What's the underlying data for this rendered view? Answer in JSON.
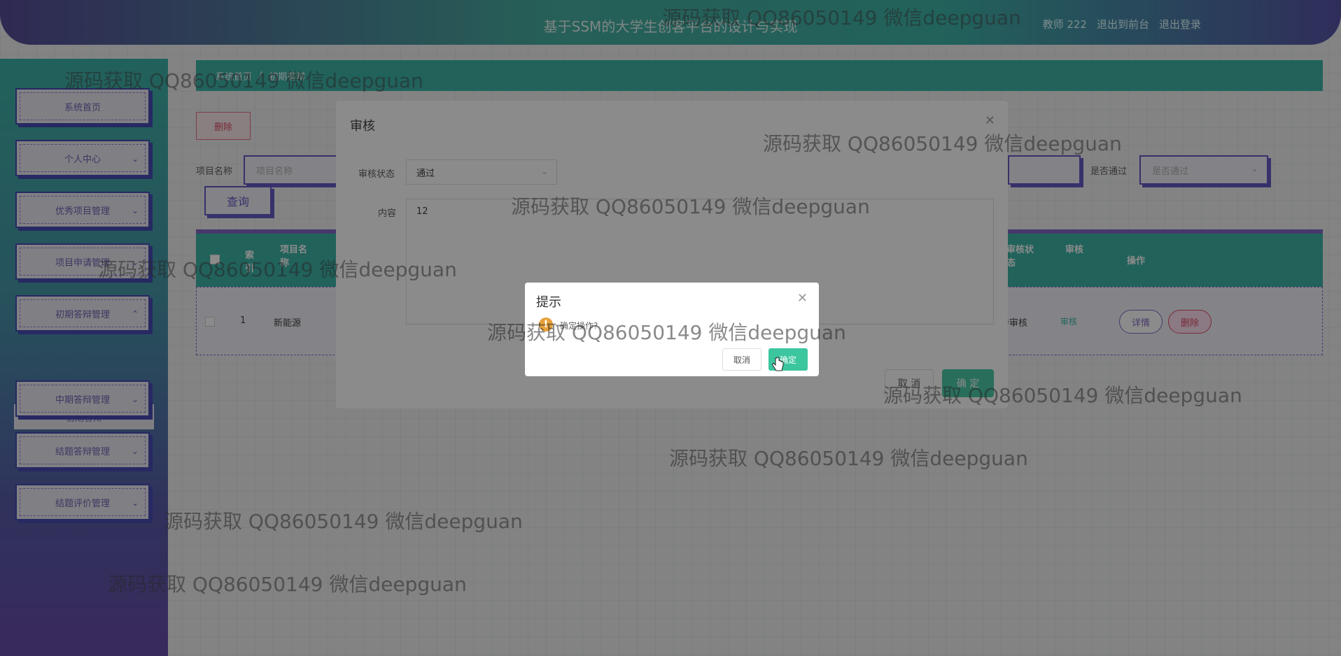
{
  "header": {
    "title": "基于SSM的大学生创客平台的设计与实现",
    "user": "教师 222",
    "back_front": "退出到前台",
    "logout": "退出登录"
  },
  "sidebar": {
    "items": [
      {
        "label": "系统首页"
      },
      {
        "label": "个人中心"
      },
      {
        "label": "优秀项目管理"
      },
      {
        "label": "项目申请管理"
      },
      {
        "label": "初期答辩管理"
      },
      {
        "label": "中期答辩管理"
      },
      {
        "label": "结题答辩管理"
      },
      {
        "label": "结题评价管理"
      }
    ],
    "submenu": "初期答辩"
  },
  "breadcrumb": {
    "home": "系统首页",
    "current": "初期答辩"
  },
  "toolbar": {
    "delete_label": "删除",
    "project_name_label": "项目名称",
    "project_name_placeholder": "项目名称",
    "passed_label": "是否通过",
    "passed_placeholder": "是否通过",
    "query_label": "查询"
  },
  "table": {
    "headers": [
      "索引",
      "项目名称",
      "审核状态",
      "审核",
      "操作"
    ],
    "rows": [
      {
        "index": "1",
        "project": "新能源",
        "status": "待审核",
        "review": "审核",
        "detail": "详情",
        "delete": "删除"
      }
    ]
  },
  "audit_dialog": {
    "title": "审核",
    "status_label": "审核状态",
    "status_value": "通过",
    "content_label": "内容",
    "content_value": "12",
    "cancel": "取 消",
    "confirm": "确 定"
  },
  "confirm_dialog": {
    "title": "提示",
    "message": "确定操作?",
    "cancel": "取消",
    "confirm": "确定"
  },
  "watermark": "源码获取 QQ86050149 微信deepguan",
  "colors": {
    "teal": "#2fb0a0",
    "purple": "#5a4fc0",
    "green_btn": "#3cc6a0",
    "danger": "#d9405a",
    "warning": "#e6a23c"
  }
}
